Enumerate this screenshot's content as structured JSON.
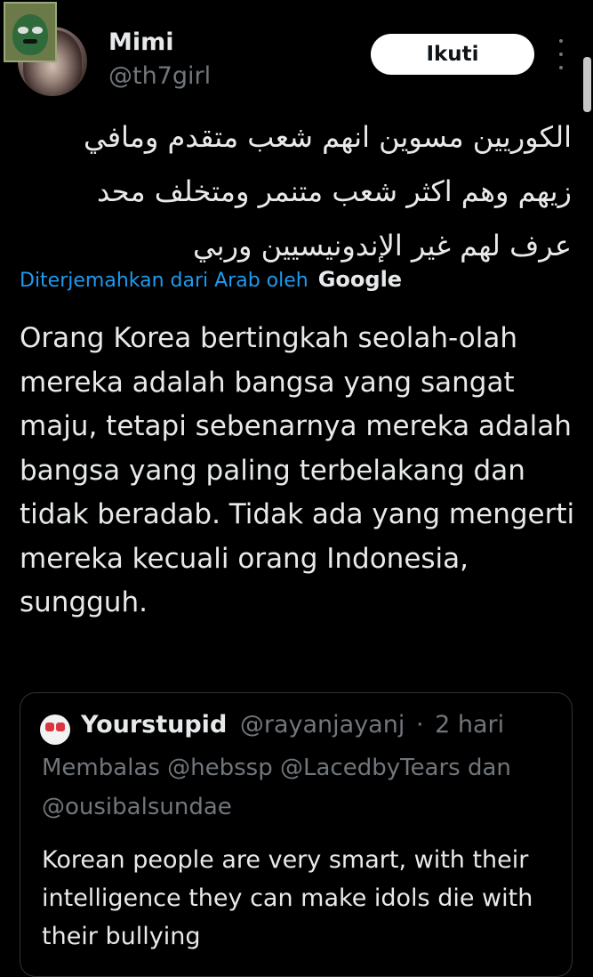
{
  "tweet": {
    "author": {
      "name": "Mimi",
      "handle": "@th7girl"
    },
    "follow_label": "Ikuti",
    "original_text": "الكوريين مسوين انهم شعب متقدم ومافي زيهم وهم اكثر شعب متنمر ومتخلف محد عرف لهم غير الإندونيسيين وربي",
    "translated_by_label": "Diterjemahkan dari Arab oleh",
    "translated_by_brand": "Google",
    "translation": "Orang Korea bertingkah seolah-olah mereka adalah bangsa yang sangat maju, tetapi sebenarnya mereka adalah bangsa yang paling terbelakang dan tidak beradab. Tidak ada yang mengerti mereka kecuali orang Indonesia, sungguh."
  },
  "quoted_tweet": {
    "name": "Yourstupid",
    "handle": "@rayanjayanj",
    "separator": "·",
    "time": "2 hari",
    "reply_context": "Membalas @hebssp @LacedbyTears dan @ousibalsundae",
    "text": "Korean people are very smart, with their intelligence they can make idols die with their bullying"
  },
  "icons": {
    "more": "more-vertical-icon",
    "sticker": "frog-sticker-icon"
  },
  "colors": {
    "background": "#000000",
    "text": "#e7e9ea",
    "muted": "#71767b",
    "link": "#1d9bf0",
    "border": "#2f3336"
  }
}
